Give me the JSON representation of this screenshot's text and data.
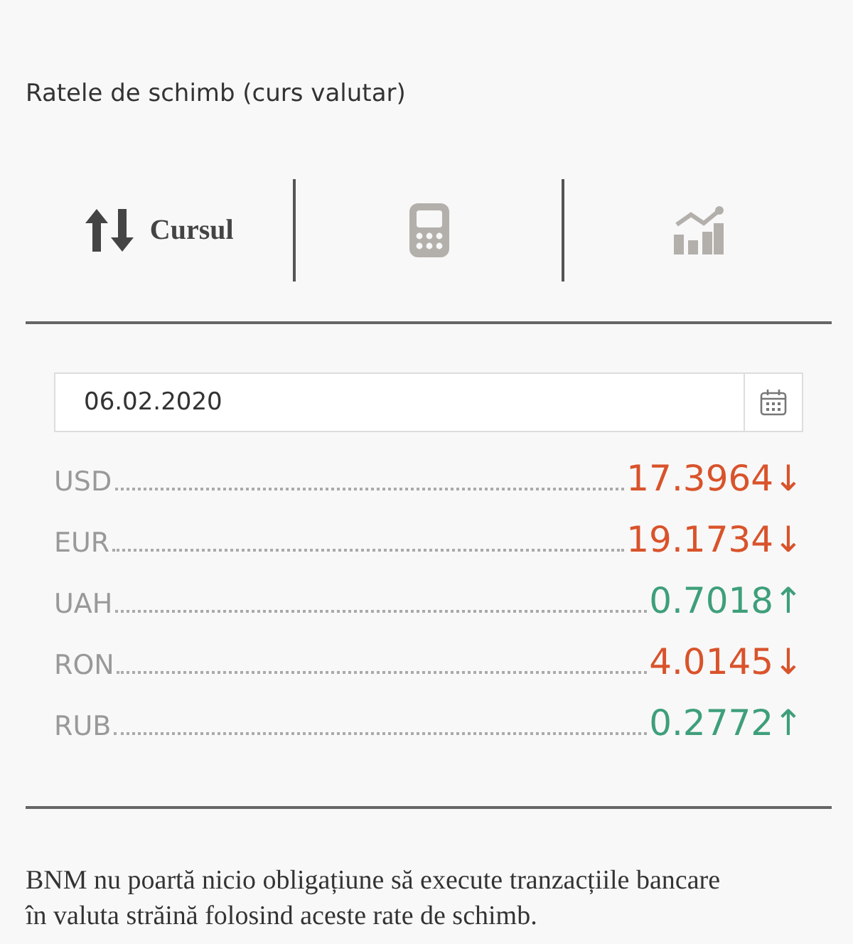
{
  "title": "Ratele de schimb (curs valutar)",
  "tabs": [
    {
      "kind": "rates",
      "label": "Cursul",
      "selected": true
    },
    {
      "kind": "calculator",
      "selected": false
    },
    {
      "kind": "chart",
      "selected": false
    }
  ],
  "date_field": {
    "value": "06.02.2020"
  },
  "rates": [
    {
      "code": "USD",
      "value": "17.3964↓",
      "rising": false
    },
    {
      "code": "EUR",
      "value": "19.1734↓",
      "rising": false
    },
    {
      "code": "UAH",
      "value": "0.7018↑",
      "rising": true
    },
    {
      "code": "RON",
      "value": "4.0145↓",
      "rising": false
    },
    {
      "code": "RUB",
      "value": "0.2772↑",
      "rising": true
    }
  ],
  "disclaimer": "BNM nu poartă nicio obligațiune să execute tranzacțiile bancare în valuta străină folosind aceste rate de schimb."
}
